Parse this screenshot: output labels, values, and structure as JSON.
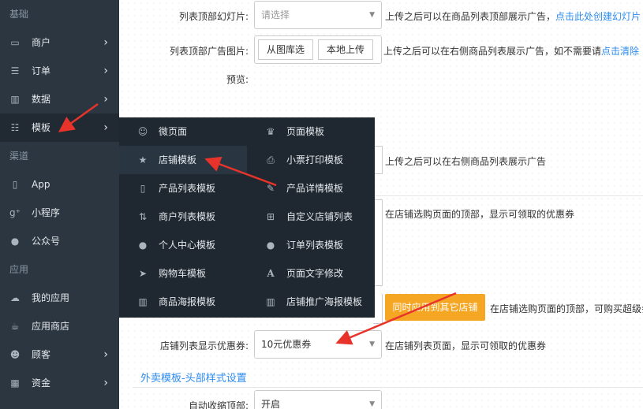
{
  "sidebar": {
    "sections": [
      {
        "title": "基础",
        "items": [
          {
            "label": "商户",
            "icon": "laptop-icon",
            "chevron": true
          },
          {
            "label": "订单",
            "icon": "list-icon",
            "chevron": true
          },
          {
            "label": "数据",
            "icon": "bar-chart-icon",
            "chevron": true
          },
          {
            "label": "模板",
            "icon": "list-ul-icon",
            "chevron": true,
            "active": true
          }
        ]
      },
      {
        "title": "渠道",
        "items": [
          {
            "label": "App",
            "icon": "tablet-icon",
            "chevron": false
          },
          {
            "label": "小程序",
            "icon": "google-plus-icon",
            "chevron": false
          },
          {
            "label": "公众号",
            "icon": "chat-icon",
            "chevron": false
          }
        ]
      },
      {
        "title": "应用",
        "items": [
          {
            "label": "我的应用",
            "icon": "cloud-icon",
            "chevron": false
          },
          {
            "label": "应用商店",
            "icon": "cup-icon",
            "chevron": false
          },
          {
            "label": "顾客",
            "icon": "users-icon",
            "chevron": true
          },
          {
            "label": "资金",
            "icon": "qrcode-icon",
            "chevron": true
          }
        ]
      }
    ]
  },
  "flyout": {
    "left": [
      {
        "label": "微页面",
        "icon": "smile-icon"
      },
      {
        "label": "店铺模板",
        "icon": "star-icon",
        "active": true
      },
      {
        "label": "产品列表模板",
        "icon": "mobile-icon"
      },
      {
        "label": "商户列表模板",
        "icon": "sort-icon"
      },
      {
        "label": "个人中心模板",
        "icon": "user-icon"
      },
      {
        "label": "购物车模板",
        "icon": "location-arrow-icon"
      },
      {
        "label": "商品海报模板",
        "icon": "bar-chart-icon"
      }
    ],
    "right": [
      {
        "label": "页面模板",
        "icon": "trophy-icon"
      },
      {
        "label": "小票打印模板",
        "icon": "print-icon"
      },
      {
        "label": "产品详情模板",
        "icon": "pencil-icon"
      },
      {
        "label": "自定义店铺列表",
        "icon": "sitemap-icon"
      },
      {
        "label": "订单列表模板",
        "icon": "user-icon"
      },
      {
        "label": "页面文字修改",
        "icon": "font-icon"
      },
      {
        "label": "店铺推广海报模板",
        "icon": "bar-chart-icon"
      }
    ]
  },
  "form": {
    "slideshow": {
      "label": "列表顶部幻灯片:",
      "placeholder": "请选择",
      "hint": "上传之后可以在商品列表顶部展示广告，",
      "link": "点击此处创建幻灯片"
    },
    "ad_image": {
      "label": "列表顶部广告图片:",
      "btn_library": "从图库选",
      "btn_upload": "本地上传",
      "hint": "上传之后可以在右侧商品列表展示广告，如不需要请",
      "link": "点击清除"
    },
    "preview_label": "预览:",
    "right_ad_hint": "上传之后可以在右侧商品列表展示广告",
    "coupon_top_hint": "在店铺选购页面的顶部，显示可领取的优惠券",
    "apply_other_btn": "同时应用到其它店铺",
    "super_member_hint": "在店铺选购页面的顶部，可购买超级会",
    "list_coupon": {
      "label": "店铺列表显示优惠券:",
      "value": "10元优惠券",
      "hint": "在店铺列表页面，显示可领取的优惠券"
    },
    "section_title": "外卖模板-头部样式设置",
    "auto_collapse": {
      "label": "自动收缩顶部:",
      "value": "开启"
    }
  },
  "colors": {
    "sidebar_bg": "#2b3640",
    "flyout_bg": "#1f2830",
    "link": "#2d8cf0",
    "accent_button": "#f5a623",
    "annotation_arrow": "#e8332a"
  }
}
